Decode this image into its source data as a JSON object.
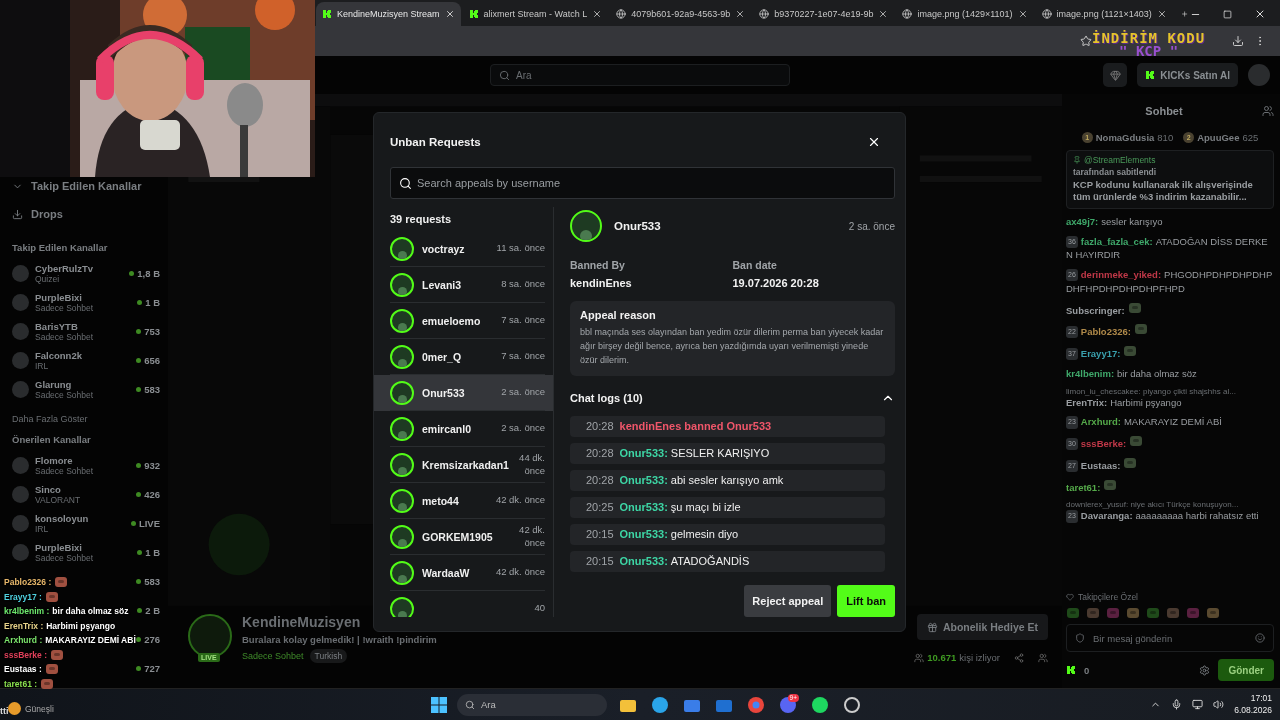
{
  "browser": {
    "tabs": [
      {
        "title": "KendineMuzisyen Stream",
        "selected": true
      },
      {
        "title": "alixmert Stream - Watch L",
        "selected": false
      },
      {
        "title": "4079b601-92a9-4563-9b",
        "selected": false
      },
      {
        "title": "b9370227-1e07-4e19-9b",
        "selected": false
      },
      {
        "title": "image.png (1429×1101)",
        "selected": false
      },
      {
        "title": "image.png (1121×1403)",
        "selected": false
      }
    ]
  },
  "promo": {
    "line1": "İNDİRİM KODU",
    "line2": "\" KCP \""
  },
  "header": {
    "search_placeholder": "Ara",
    "buy_button": "KICKs Satın Al"
  },
  "sidebar": {
    "collapsed_item": "Takip Edilen Kanallar",
    "drops": "Drops",
    "followed_title": "Takip Edilen Kanallar",
    "followed": [
      {
        "name": "CyberRulzTv",
        "category": "Quizei",
        "viewers": "1,8 B"
      },
      {
        "name": "PurpleBixi",
        "category": "Sadece Sohbet",
        "viewers": "1 B"
      },
      {
        "name": "BarisYTB",
        "category": "Sadece Sohbet",
        "viewers": "753"
      },
      {
        "name": "Falconn2k",
        "category": "IRL",
        "viewers": "656"
      },
      {
        "name": "Glarung",
        "category": "Sadece Sohbet",
        "viewers": "583"
      }
    ],
    "show_more": "Daha Fazla Göster",
    "recommended_title": "Önerilen Kanallar",
    "recommended": [
      {
        "name": "Flomore",
        "category": "Sadece Sohbet",
        "viewers": "932"
      },
      {
        "name": "Sinco",
        "category": "VALORANT",
        "viewers": "426"
      },
      {
        "name": "konsoloyun",
        "category": "IRL",
        "viewers": "LIVE"
      },
      {
        "name": "PurpleBixi",
        "category": "Sadece Sohbet",
        "viewers": "1 B"
      },
      {
        "viewers": "583"
      },
      {
        "viewers": "2 B"
      },
      {
        "viewers": "276"
      },
      {
        "viewers": "727"
      }
    ]
  },
  "stream": {
    "streamer": "KendineMuzisyen",
    "live": "LIVE",
    "title": "Buralara kolay gelmedik! | !wraith !pindirim",
    "category": "Sadece Sohbet",
    "tag": "Turkish",
    "gift_button": "Abonelik Hediye Et",
    "viewers": "10.671",
    "viewers_label": "kişi izliyor"
  },
  "overlay_chat": [
    {
      "user": "Pablo2326 :",
      "color": "#e8b86b",
      "kind": "emote"
    },
    {
      "user": "Erayy17 :",
      "color": "#4fd1e0",
      "kind": "emote"
    },
    {
      "user": "kr4lbenim :",
      "color": "#6de86d",
      "kind": "text",
      "text": "bir daha olmaz söz"
    },
    {
      "user": "ErenTrix :",
      "color": "#e8d38a",
      "kind": "text",
      "text": "Harbimi pşyango"
    },
    {
      "user": "Arxhurd :",
      "color": "#7be36b",
      "kind": "text",
      "text": "MAKARAYIZ DEMİ ABİ"
    },
    {
      "user": "sssBerke :",
      "color": "#e0405a",
      "kind": "emote"
    },
    {
      "user": "Eustaas :",
      "color": "#ffffff",
      "kind": "emote"
    },
    {
      "user": "taret61 :",
      "color": "#8be04f",
      "kind": "emote"
    }
  ],
  "overlay_fragment": "tti",
  "chat": {
    "title": "Sohbet",
    "leaders": [
      {
        "rank": "1",
        "name": "NomaGdusia",
        "points": "810"
      },
      {
        "rank": "2",
        "name": "ApuuGee",
        "points": "625"
      }
    ],
    "pinned": {
      "author": "@StreamElements",
      "note": "tarafından sabitlendi",
      "text": "KCP kodunu kullanarak ilk alışverişinde tüm ürünlerde %3 indirim kazanabilir..."
    },
    "messages": [
      {
        "user": "ax49j7:",
        "color": "#3fa86a",
        "kind": "text",
        "text": "sesler karışıyo"
      },
      {
        "badge": "36",
        "user": "fazla_fazla_cek:",
        "color": "#3fa86a",
        "kind": "text",
        "text": "ATADOĞAN DİSS DERKEN HAYIRDIR"
      },
      {
        "badge": "26",
        "user": "derinmeke_yiked:",
        "color": "#c03848",
        "kind": "text",
        "text": "PHGODHPDHPDHPDHPDHFHPDHPDHPDHPFHPD"
      },
      {
        "user": "Subscringer:",
        "color": "#9a9ea2",
        "kind": "emote"
      },
      {
        "badge": "22",
        "user": "Pablo2326:",
        "color": "#b08a4a",
        "kind": "emote"
      },
      {
        "badge": "37",
        "user": "Erayy17:",
        "color": "#3aa0ad",
        "kind": "emote"
      },
      {
        "user": "kr4lbenim:",
        "color": "#3fa86a",
        "kind": "text",
        "text": "bir daha olmaz söz"
      },
      {
        "reply": "limon_iu_chescakee: piyango çikti shajshhs al...",
        "user": "ErenTrix:",
        "color": "#9a9ea2",
        "kind": "text",
        "text": "Harbimi pşyango"
      },
      {
        "badge": "23",
        "user": "Arxhurd:",
        "color": "#55aa4a",
        "kind": "text",
        "text": "MAKARAYIZ DEMİ ABİ"
      },
      {
        "badge": "30",
        "user": "sssBerke:",
        "color": "#c03848",
        "kind": "emote"
      },
      {
        "badge": "27",
        "user": "Eustaas:",
        "color": "#9a9ea2",
        "kind": "emote"
      },
      {
        "user": "taret61:",
        "color": "#55aa4a",
        "kind": "emote"
      },
      {
        "reply": "downlerex_yusuf: niye akıcı Türkçe konuşuyon...",
        "badge": "23",
        "user": "Davaranga:",
        "color": "#9a9ea2",
        "kind": "text",
        "text": "aaaaaaaaa harbi rahatsız etti"
      }
    ],
    "followers_only": "Takipçilere Özel",
    "input_placeholder": "Bir mesaj gönderin",
    "points": "0",
    "send_button": "Gönder"
  },
  "modal": {
    "title": "Unban Requests",
    "search_placeholder": "Search appeals by username",
    "count": "39 requests",
    "requests": [
      {
        "name": "voctrayz",
        "time": "11 sa. önce",
        "selected": false
      },
      {
        "name": "Levani3",
        "time": "8 sa. önce",
        "selected": false
      },
      {
        "name": "emueloemo",
        "time": "7 sa. önce",
        "selected": false
      },
      {
        "name": "0mer_Q",
        "time": "7 sa. önce",
        "selected": false
      },
      {
        "name": "Onur533",
        "time": "2 sa. önce",
        "selected": true
      },
      {
        "name": "emircanl0",
        "time": "2 sa. önce",
        "selected": false
      },
      {
        "name": "Kremsizarkadan1",
        "time": "44 dk. önce",
        "selected": false
      },
      {
        "name": "meto44",
        "time": "42 dk. önce",
        "selected": false
      },
      {
        "name": "GORKEM1905",
        "time": "42 dk. önce",
        "selected": false
      },
      {
        "name": "WardaaW",
        "time": "42 dk. önce",
        "selected": false
      },
      {
        "time": "40",
        "selected": false
      }
    ],
    "detail": {
      "name": "Onur533",
      "time": "2 sa. önce",
      "banned_by_label": "Banned By",
      "banned_by": "kendinEnes",
      "ban_date_label": "Ban date",
      "ban_date": "19.07.2026 20:28",
      "reason_title": "Appeal reason",
      "reason": "bbl maçında ses olayından ban yedim özür dilerim perma ban yiyecek kadar ağır birşey değil bence, ayrıca ben yazdığımda uyarı verilmemişti yinede özür dilerim.",
      "logs_title": "Chat logs (10)",
      "expanded": true,
      "logs": [
        {
          "time": "20:28",
          "kind": "ban",
          "text": "kendinEnes banned Onur533"
        },
        {
          "time": "20:28",
          "kind": "message",
          "user": "Onur533:",
          "text": "SESLER KARIŞIYO"
        },
        {
          "time": "20:28",
          "kind": "message",
          "user": "Onur533:",
          "text": "abi sesler karışıyo amk"
        },
        {
          "time": "20:25",
          "kind": "message",
          "user": "Onur533:",
          "text": "şu maçı bi izle"
        },
        {
          "time": "20:15",
          "kind": "message",
          "user": "Onur533:",
          "text": "gelmesin diyo"
        },
        {
          "time": "20:15",
          "kind": "message",
          "user": "Onur533:",
          "text": "ATADOĞANDİS"
        }
      ]
    },
    "reject_button": "Reject appeal",
    "lift_button": "Lift ban"
  },
  "taskbar": {
    "weather": "Güneşli",
    "search_placeholder": "Ara",
    "chat_badge": "9+",
    "time": "17:01",
    "date": "6.08.2026"
  }
}
